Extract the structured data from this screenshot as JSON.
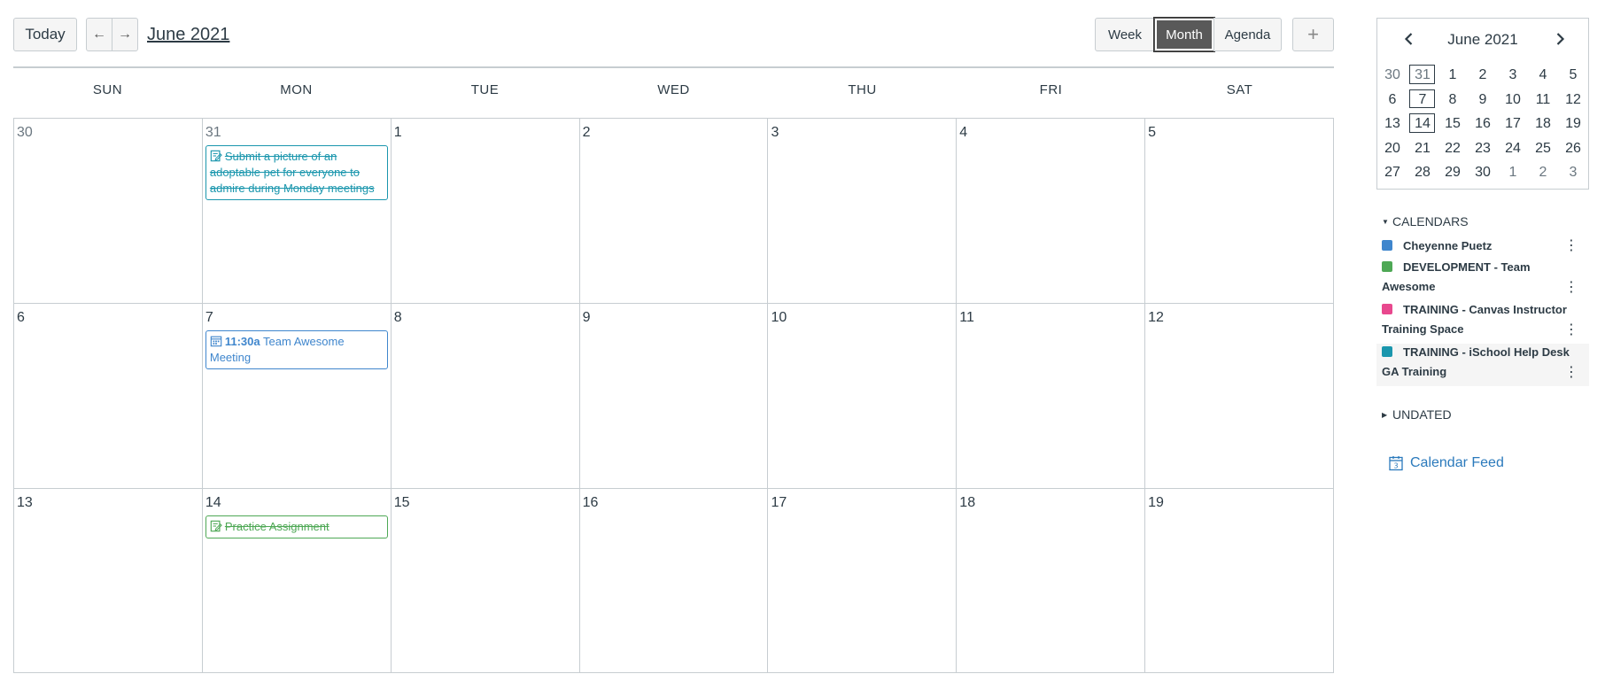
{
  "header": {
    "today_label": "Today",
    "prev_label": "←",
    "next_label": "→",
    "title": "June 2021",
    "views": [
      "Week",
      "Month",
      "Agenda"
    ],
    "active_view": "Month",
    "add_label": "+"
  },
  "grid": {
    "weekdays": [
      "SUN",
      "MON",
      "TUE",
      "WED",
      "THU",
      "FRI",
      "SAT"
    ],
    "weeks": [
      [
        "30",
        "31",
        "1",
        "2",
        "3",
        "4",
        "5"
      ],
      [
        "6",
        "7",
        "8",
        "9",
        "10",
        "11",
        "12"
      ],
      [
        "13",
        "14",
        "15",
        "16",
        "17",
        "18",
        "19"
      ]
    ],
    "events": [
      {
        "title": "Submit a picture of an adoptable pet for everyone to admire during Monday meetings",
        "time": "",
        "icon": "assignment-icon",
        "color": "#1a96ad",
        "completed": true
      },
      {
        "title": "Team Awesome Meeting",
        "time": "11:30a",
        "icon": "calendar-event-icon",
        "color": "#3f86cd",
        "completed": false
      },
      {
        "title": "Practice Assignment",
        "time": "",
        "icon": "assignment-icon",
        "color": "#4ea855",
        "completed": true
      }
    ]
  },
  "mini_calendar": {
    "title": "June 2021",
    "weeks": [
      [
        "30",
        "31",
        "1",
        "2",
        "3",
        "4",
        "5"
      ],
      [
        "6",
        "7",
        "8",
        "9",
        "10",
        "11",
        "12"
      ],
      [
        "13",
        "14",
        "15",
        "16",
        "17",
        "18",
        "19"
      ],
      [
        "20",
        "21",
        "22",
        "23",
        "24",
        "25",
        "26"
      ],
      [
        "27",
        "28",
        "29",
        "30",
        "1",
        "2",
        "3"
      ]
    ]
  },
  "sidebar": {
    "calendars_heading": "CALENDARS",
    "calendars": [
      {
        "name": "Cheyenne Puetz",
        "color": "#3f86cd"
      },
      {
        "name": "DEVELOPMENT - Team Awesome",
        "color": "#4ea855"
      },
      {
        "name": "TRAINING - Canvas Instructor Training Space",
        "color": "#e8488e"
      },
      {
        "name": "TRAINING - iSchool Help Desk GA Training",
        "color": "#1a96ad"
      }
    ],
    "undated_heading": "UNDATED",
    "feed_label": "Calendar Feed"
  }
}
